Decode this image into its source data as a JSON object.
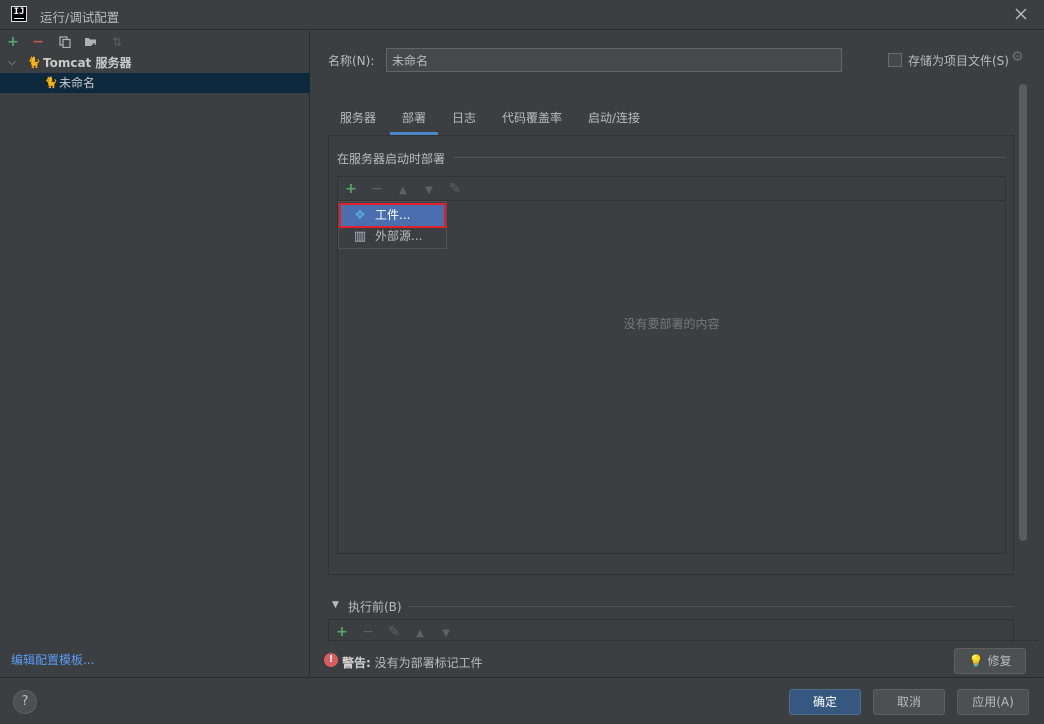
{
  "window": {
    "title": "运行/调试配置"
  },
  "tree": {
    "group_label": "Tomcat 服务器",
    "item_label": "未命名"
  },
  "left_footer": {
    "edit_templates": "编辑配置模板..."
  },
  "config": {
    "name_label": "名称(N):",
    "name_value": "未命名",
    "store_label": "存储为项目文件(S)"
  },
  "tabs": [
    {
      "label": "服务器"
    },
    {
      "label": "部署"
    },
    {
      "label": "日志"
    },
    {
      "label": "代码覆盖率"
    },
    {
      "label": "启动/连接"
    }
  ],
  "deploy": {
    "section_title": "在服务器启动时部署",
    "empty_text": "没有要部署的内容",
    "popup_items": [
      {
        "label": "工件..."
      },
      {
        "label": "外部源..."
      }
    ]
  },
  "before_run": {
    "label": "执行前(B)"
  },
  "warning": {
    "prefix": "警告:",
    "message": "没有为部署标记工件",
    "fix_label": "修复"
  },
  "footer": {
    "help": "?",
    "ok": "确定",
    "cancel": "取消",
    "apply": "应用(A)"
  },
  "colors": {
    "accent": "#4a88c7",
    "selection": "#4b6eaf",
    "highlight_border": "#e0202c",
    "add_green": "#59a869",
    "remove_red": "#c75450",
    "link": "#589df6",
    "error": "#db5c5c"
  }
}
